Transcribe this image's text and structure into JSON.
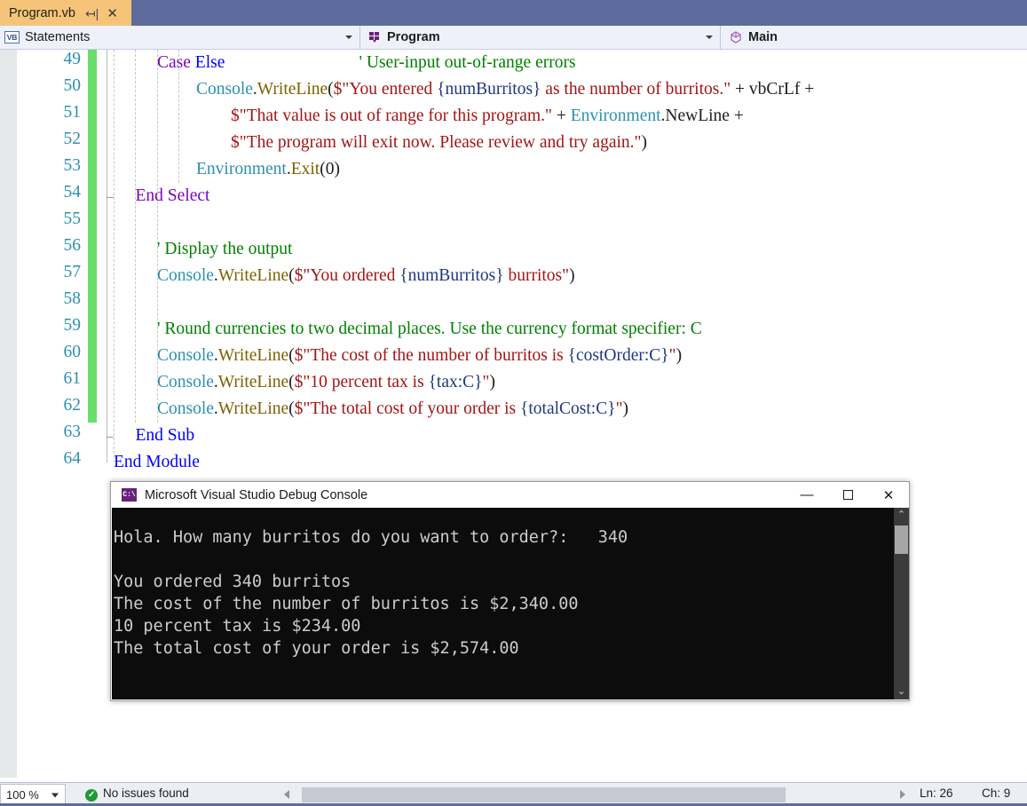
{
  "window": {
    "tab": {
      "label": "Program.vb",
      "pin_icon": "pin-icon",
      "close_icon": "close-icon"
    }
  },
  "navbar": {
    "project_dropdown": {
      "icon": "vb-file-icon",
      "value": "Statements"
    },
    "type_dropdown": {
      "icon": "module-icon",
      "value": "Program"
    },
    "member_dropdown": {
      "icon": "method-icon",
      "value": "Main"
    }
  },
  "editor": {
    "first_line": 49,
    "lines": [
      {
        "n": "49",
        "tokens": [
          {
            "t": "Case ",
            "c": "kw"
          },
          {
            "t": "Else",
            "c": "kw2"
          },
          {
            "t": "                               ",
            "c": "pun"
          },
          {
            "t": "' User-input out-of-range errors",
            "c": "com"
          }
        ],
        "indent": 2
      },
      {
        "n": "50",
        "tokens": [
          {
            "t": "    ",
            "c": "pun"
          },
          {
            "t": "Console",
            "c": "cls"
          },
          {
            "t": ".",
            "c": "pun"
          },
          {
            "t": "WriteLine",
            "c": "mem"
          },
          {
            "t": "(",
            "c": "pun"
          },
          {
            "t": "$\"You entered ",
            "c": "str"
          },
          {
            "t": "{numBurritos}",
            "c": "id"
          },
          {
            "t": " as the number of burritos.\"",
            "c": "str"
          },
          {
            "t": " + vbCrLf +",
            "c": "pun"
          }
        ],
        "indent": 3
      },
      {
        "n": "51",
        "tokens": [
          {
            "t": "            ",
            "c": "pun"
          },
          {
            "t": "$\"That value is out of range for this program.\"",
            "c": "str"
          },
          {
            "t": " + ",
            "c": "pun"
          },
          {
            "t": "Environment",
            "c": "cls"
          },
          {
            "t": ".NewLine +",
            "c": "pun"
          }
        ],
        "indent": 3
      },
      {
        "n": "52",
        "tokens": [
          {
            "t": "            ",
            "c": "pun"
          },
          {
            "t": "$\"The program will exit now. Please review and try again.\"",
            "c": "str"
          },
          {
            "t": ")",
            "c": "pun"
          }
        ],
        "indent": 3
      },
      {
        "n": "53",
        "tokens": [
          {
            "t": "    ",
            "c": "pun"
          },
          {
            "t": "Environment",
            "c": "cls"
          },
          {
            "t": ".",
            "c": "pun"
          },
          {
            "t": "Exit",
            "c": "mem"
          },
          {
            "t": "(0)",
            "c": "pun"
          }
        ],
        "indent": 3
      },
      {
        "n": "54",
        "tokens": [
          {
            "t": "End Select",
            "c": "kw"
          }
        ],
        "indent": 1
      },
      {
        "n": "55",
        "tokens": [],
        "indent": 0
      },
      {
        "n": "56",
        "tokens": [
          {
            "t": "' Display the output",
            "c": "com"
          }
        ],
        "indent": 2
      },
      {
        "n": "57",
        "tokens": [
          {
            "t": "Console",
            "c": "cls"
          },
          {
            "t": ".",
            "c": "pun"
          },
          {
            "t": "WriteLine",
            "c": "mem"
          },
          {
            "t": "(",
            "c": "pun"
          },
          {
            "t": "$\"You ordered ",
            "c": "str"
          },
          {
            "t": "{numBurritos}",
            "c": "id"
          },
          {
            "t": " burritos\"",
            "c": "str"
          },
          {
            "t": ")",
            "c": "pun"
          }
        ],
        "indent": 2
      },
      {
        "n": "58",
        "tokens": [],
        "indent": 0
      },
      {
        "n": "59",
        "tokens": [
          {
            "t": "' Round currencies to two decimal places. Use the currency format specifier: C",
            "c": "com"
          }
        ],
        "indent": 2
      },
      {
        "n": "60",
        "tokens": [
          {
            "t": "Console",
            "c": "cls"
          },
          {
            "t": ".",
            "c": "pun"
          },
          {
            "t": "WriteLine",
            "c": "mem"
          },
          {
            "t": "(",
            "c": "pun"
          },
          {
            "t": "$\"The cost of the number of burritos is ",
            "c": "str"
          },
          {
            "t": "{costOrder:C}",
            "c": "id"
          },
          {
            "t": "\"",
            "c": "str"
          },
          {
            "t": ")",
            "c": "pun"
          }
        ],
        "indent": 2
      },
      {
        "n": "61",
        "tokens": [
          {
            "t": "Console",
            "c": "cls"
          },
          {
            "t": ".",
            "c": "pun"
          },
          {
            "t": "WriteLine",
            "c": "mem"
          },
          {
            "t": "(",
            "c": "pun"
          },
          {
            "t": "$\"10 percent tax is ",
            "c": "str"
          },
          {
            "t": "{tax:C}",
            "c": "id"
          },
          {
            "t": "\"",
            "c": "str"
          },
          {
            "t": ")",
            "c": "pun"
          }
        ],
        "indent": 2
      },
      {
        "n": "62",
        "tokens": [
          {
            "t": "Console",
            "c": "cls"
          },
          {
            "t": ".",
            "c": "pun"
          },
          {
            "t": "WriteLine",
            "c": "mem"
          },
          {
            "t": "(",
            "c": "pun"
          },
          {
            "t": "$\"The total cost of your order is ",
            "c": "str"
          },
          {
            "t": "{totalCost:C}",
            "c": "id"
          },
          {
            "t": "\"",
            "c": "str"
          },
          {
            "t": ")",
            "c": "pun"
          }
        ],
        "indent": 2
      },
      {
        "n": "63",
        "tokens": [
          {
            "t": "End Sub",
            "c": "kw2"
          }
        ],
        "indent": 1
      },
      {
        "n": "64",
        "tokens": [
          {
            "t": "End Module",
            "c": "kw2"
          }
        ],
        "indent": 0
      }
    ]
  },
  "console": {
    "title": "Microsoft Visual Studio Debug Console",
    "icon": "console-app-icon",
    "minimize_label": "—",
    "maximize_label": "☐",
    "close_label": "✕",
    "output": "Hola. How many burritos do you want to order?:   340\n\nYou ordered 340 burritos\nThe cost of the number of burritos is $2,340.00\n10 percent tax is $234.00\nThe total cost of your order is $2,574.00",
    "scroll_up": "⌃",
    "scroll_down": "⌄"
  },
  "status": {
    "zoom": "100 %",
    "issues": "No issues found",
    "issues_icon": "success-check-icon",
    "line": "Ln: 26",
    "column": "Ch: 9"
  }
}
